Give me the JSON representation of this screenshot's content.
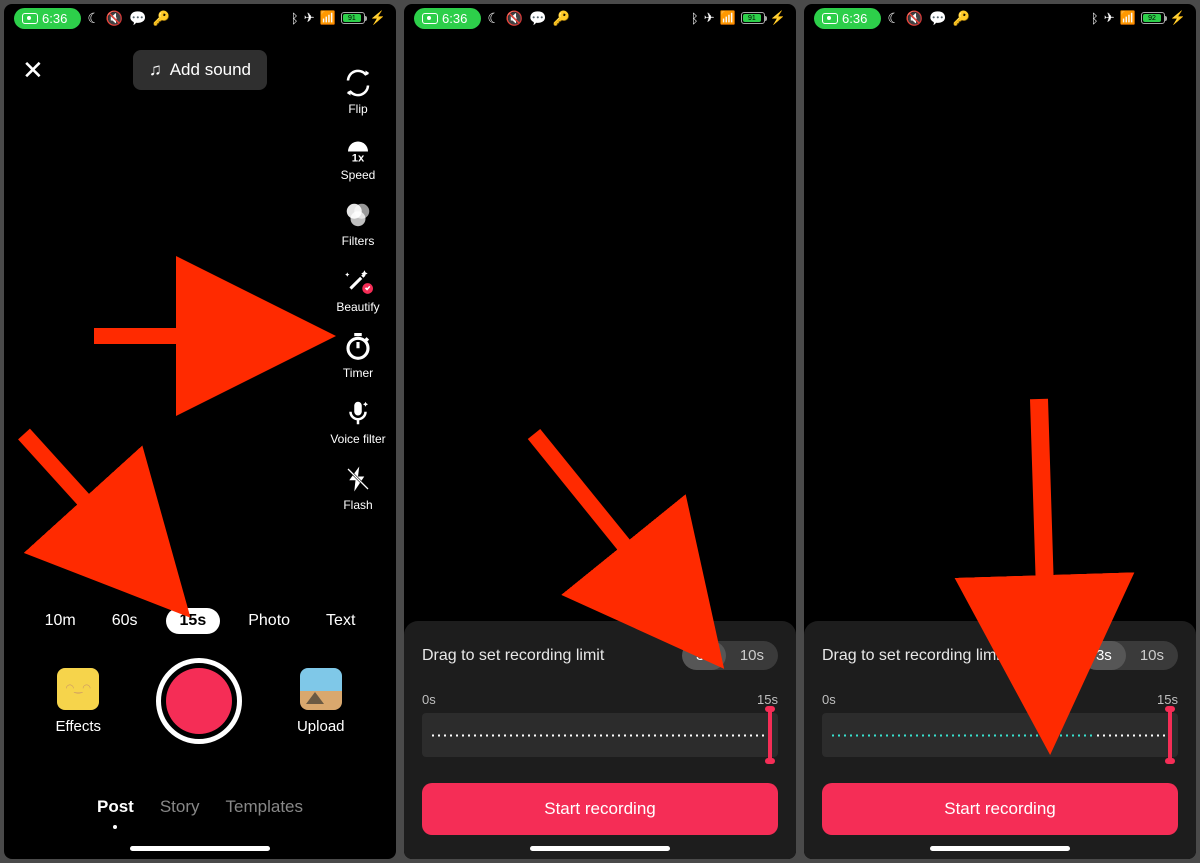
{
  "status": {
    "time": "6:36",
    "icons_left": [
      "moon-icon",
      "vibrate-icon",
      "chat-icon",
      "key-icon"
    ],
    "icons_right": [
      "bluetooth-icon",
      "airplane-icon",
      "wifi-icon"
    ],
    "battery1": "91",
    "battery2": "91",
    "battery3": "92"
  },
  "phone1": {
    "add_sound": "Add sound",
    "tools": [
      {
        "label": "Flip",
        "name": "flip-icon"
      },
      {
        "label": "Speed",
        "name": "speed-icon"
      },
      {
        "label": "Filters",
        "name": "filters-icon"
      },
      {
        "label": "Beautify",
        "name": "beautify-icon"
      },
      {
        "label": "Timer",
        "name": "timer-icon"
      },
      {
        "label": "Voice filter",
        "name": "voice-filter-icon"
      },
      {
        "label": "Flash",
        "name": "flash-icon"
      }
    ],
    "durations": [
      "10m",
      "60s",
      "15s",
      "Photo",
      "Text"
    ],
    "active_duration_index": 2,
    "effects": "Effects",
    "upload": "Upload",
    "post_tabs": [
      "Post",
      "Story",
      "Templates"
    ],
    "active_post_index": 0
  },
  "timer_panel": {
    "title": "Drag to set recording limit",
    "seg": [
      "3s",
      "10s"
    ],
    "active_seg_index": 0,
    "start_label": "0s",
    "end_label": "15s",
    "start_btn": "Start recording"
  }
}
